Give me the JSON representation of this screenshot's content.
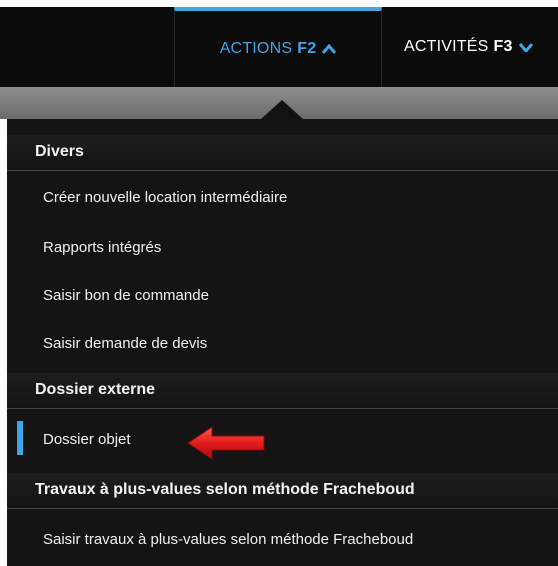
{
  "topbar": {
    "tabs": [
      {
        "label": "ACTIONS",
        "key": "F2",
        "chevron": "chevron-up-icon",
        "active": true
      },
      {
        "label": "ACTIVITÉS",
        "key": "F3",
        "chevron": "chevron-down-icon",
        "active": false
      }
    ]
  },
  "menu": {
    "sections": [
      {
        "title": "Divers",
        "items": [
          "Créer nouvelle location intermédiaire",
          "Rapports intégrés",
          "Saisir bon de commande",
          "Saisir demande de devis"
        ]
      },
      {
        "title": "Dossier externe",
        "items": [
          "Dossier objet"
        ]
      },
      {
        "title": "Travaux à plus-values selon méthode Fracheboud",
        "items": [
          "Saisir travaux à plus-values selon méthode Fracheboud"
        ]
      }
    ],
    "selected_item": "Dossier objet"
  },
  "colors": {
    "accent": "#3ea6e6",
    "annotation_arrow": "#e31b1b",
    "menu_background": "#141414",
    "topbar_background": "#0b0b0b"
  }
}
